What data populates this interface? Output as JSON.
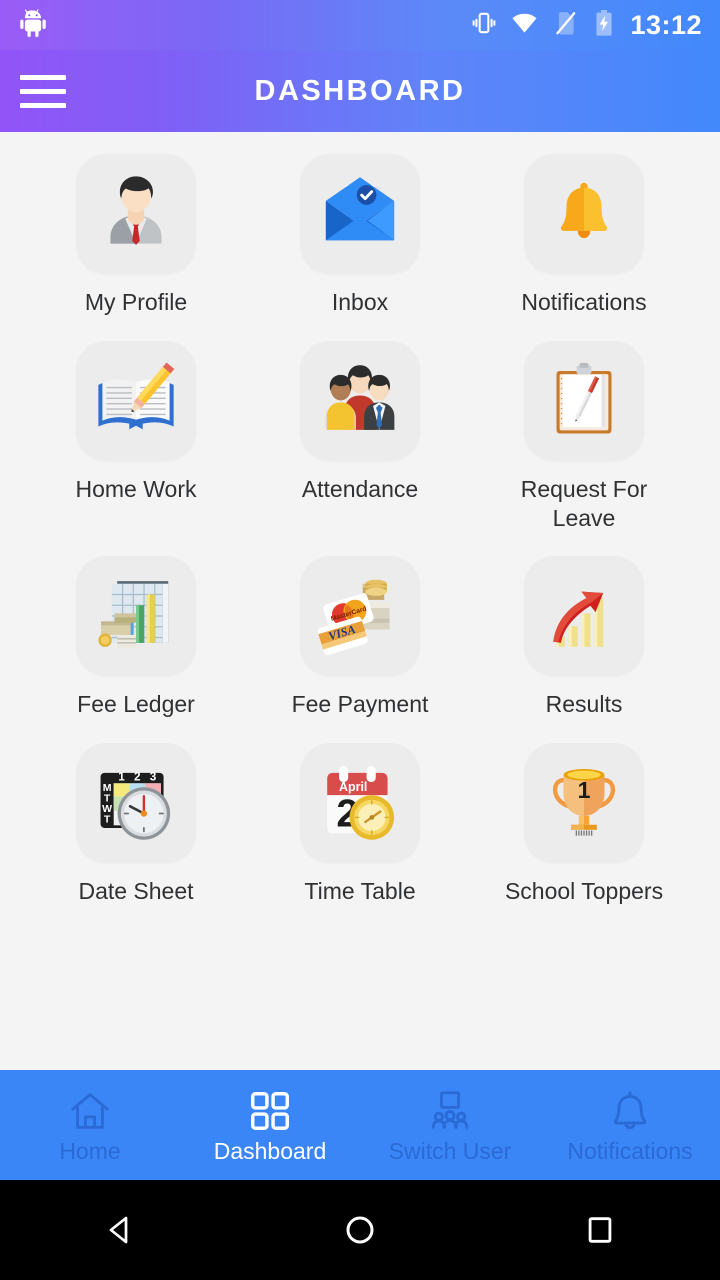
{
  "status_bar": {
    "time": "13:12",
    "icons": [
      "vibrate-icon",
      "wifi-icon",
      "no-sim-icon",
      "battery-charging-icon"
    ],
    "android_logo": "android-head-icon"
  },
  "app_bar": {
    "title": "DASHBOARD",
    "menu_icon": "hamburger-menu-icon",
    "gradient_start": "#9254F7",
    "gradient_end": "#4289FC"
  },
  "theme": {
    "background": "#f4f4f4",
    "tile_background": "#ececec",
    "label_color": "#2f3133",
    "nav_bar_background": "#3b86f7",
    "nav_active_color": "#ffffff",
    "nav_inactive_color": "#2a6ad6"
  },
  "grid": {
    "items": [
      {
        "label": "My Profile",
        "icon": "user-profile-icon"
      },
      {
        "label": "Inbox",
        "icon": "envelope-check-icon"
      },
      {
        "label": "Notifications",
        "icon": "bell-icon"
      },
      {
        "label": "Home Work",
        "icon": "open-book-pencil-icon"
      },
      {
        "label": "Attendance",
        "icon": "people-group-icon"
      },
      {
        "label": "Request For Leave",
        "icon": "clipboard-pen-icon"
      },
      {
        "label": "Fee Ledger",
        "icon": "bar-chart-money-icon"
      },
      {
        "label": "Fee Payment",
        "icon": "credit-cards-cash-icon"
      },
      {
        "label": "Results",
        "icon": "growth-arrow-chart-icon"
      },
      {
        "label": "Date Sheet",
        "icon": "calendar-clock-icon"
      },
      {
        "label": "Time Table",
        "icon": "calendar-april-clock-icon"
      },
      {
        "label": "School Toppers",
        "icon": "trophy-icon"
      }
    ]
  },
  "bottom_nav": {
    "items": [
      {
        "label": "Home",
        "icon": "home-icon",
        "active": false
      },
      {
        "label": "Dashboard",
        "icon": "grid-squares-icon",
        "active": true
      },
      {
        "label": "Switch User",
        "icon": "switch-user-icon",
        "active": false
      },
      {
        "label": "Notifications",
        "icon": "bell-outline-icon",
        "active": false
      }
    ]
  },
  "android_nav": {
    "back": "back-triangle-icon",
    "home": "home-circle-icon",
    "recents": "recents-square-icon"
  }
}
